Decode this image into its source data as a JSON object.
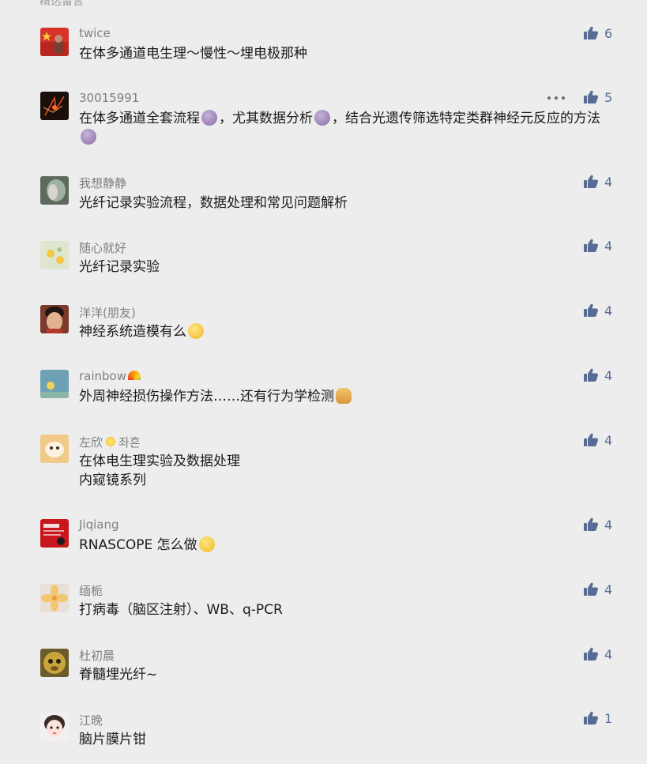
{
  "section_header": "精选留言",
  "comments": [
    {
      "nickname": "twice",
      "text": "在体多通道电生理～慢性～埋电极那种",
      "likes": "6"
    },
    {
      "nickname": "30015991",
      "text_parts": [
        "在体多通道全套流程",
        "，尤其数据分析",
        "，结合光遗传筛选特定类群神经元反应的方法"
      ],
      "likes": "5"
    },
    {
      "nickname": "我想静静",
      "text": "光纤记录实验流程，数据处理和常见问题解析",
      "likes": "4"
    },
    {
      "nickname": "随心就好",
      "text": "光纤记录实验",
      "likes": "4"
    },
    {
      "nickname": "洋洋(朋友)",
      "text": "神经系统造模有么",
      "likes": "4"
    },
    {
      "nickname": "rainbow",
      "text": "外周神经损伤操作方法……还有行为学检测",
      "likes": "4"
    },
    {
      "nickname_a": "左欣",
      "nickname_b": "좌흔",
      "text_line1": "在体电生理实验及数据处理",
      "text_line2": "内窥镜系列",
      "likes": "4"
    },
    {
      "nickname": "Jiqiang",
      "text": "RNASCOPE 怎么做",
      "likes": "4"
    },
    {
      "nickname": "缅栀",
      "text": "打病毒（脑区注射）、WB、q-PCR",
      "likes": "4"
    },
    {
      "nickname": "杜初晨",
      "text": "脊髓埋光纤~",
      "likes": "4"
    },
    {
      "nickname": "江晚",
      "text": "脑片膜片钳",
      "likes": "1"
    }
  ],
  "icons": {
    "like": "thumbs-up-icon",
    "more": "more-dots-icon"
  },
  "colors": {
    "background": "#ededed",
    "like_accent": "#576b95",
    "nickname": "#7f7f7f",
    "content": "#1a1a1a"
  }
}
